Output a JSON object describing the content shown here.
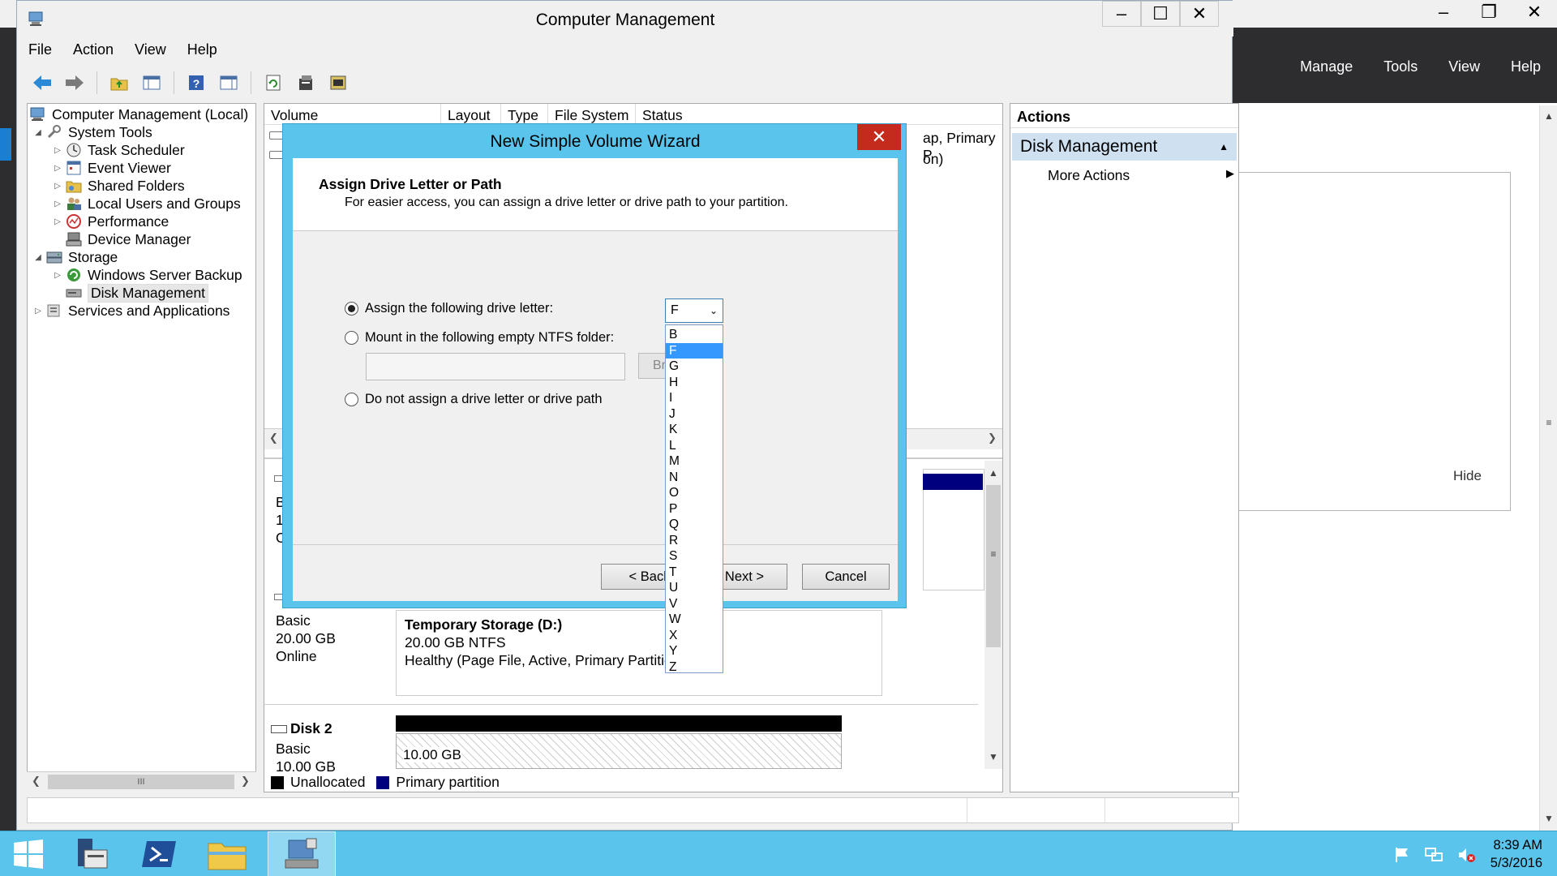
{
  "background": {
    "menu": [
      "Manage",
      "Tools",
      "View",
      "Help"
    ],
    "hide_label": "Hide"
  },
  "window": {
    "title": "Computer Management",
    "menu": [
      "File",
      "Action",
      "View",
      "Help"
    ]
  },
  "tree": {
    "root": "Computer Management (Local)",
    "system_tools": "System Tools",
    "task_scheduler": "Task Scheduler",
    "event_viewer": "Event Viewer",
    "shared_folders": "Shared Folders",
    "local_users": "Local Users and Groups",
    "performance": "Performance",
    "device_manager": "Device Manager",
    "storage": "Storage",
    "wsb": "Windows Server Backup",
    "disk_management": "Disk Management",
    "services": "Services and Applications",
    "scroll_grip": "III"
  },
  "volume_list": {
    "columns": [
      "Volume",
      "Layout",
      "Type",
      "File System",
      "Status"
    ],
    "fragment_status_1": "ap, Primary P",
    "fragment_status_2": "on)"
  },
  "disks": {
    "partial_b": "B",
    "partial_1": "1.",
    "partial_o": "O",
    "disk1_type": "Basic",
    "disk1_size": "20.00 GB",
    "disk1_state": "Online",
    "disk1_vol_name": "Temporary Storage  (D:)",
    "disk1_vol_fs": "20.00 GB NTFS",
    "disk1_vol_status": "Healthy (Page File, Active, Primary Partitio",
    "disk2_name": "Disk 2",
    "disk2_type": "Basic",
    "disk2_size": "10.00 GB",
    "disk2_unalloc_size": "10.00 GB",
    "legend_unallocated": "Unallocated",
    "legend_primary": "Primary partition",
    "color_unallocated": "#000000",
    "color_primary": "#00007f"
  },
  "actions": {
    "header": "Actions",
    "section": "Disk Management",
    "more": "More Actions"
  },
  "wizard": {
    "title": "New Simple Volume Wizard",
    "close_glyph": "✕",
    "heading": "Assign Drive Letter or Path",
    "description": "For easier access, you can assign a drive letter or drive path to your partition.",
    "option_assign": "Assign the following drive letter:",
    "option_mount": "Mount in the following empty NTFS folder:",
    "option_none": "Do not assign a drive letter or drive path",
    "browse_partial": "Bro",
    "back_label": "< Back",
    "next_label": "Next >",
    "cancel_label": "Cancel",
    "selected_letter": "F",
    "letters": [
      "B",
      "F",
      "G",
      "H",
      "I",
      "J",
      "K",
      "L",
      "M",
      "N",
      "O",
      "P",
      "Q",
      "R",
      "S",
      "T",
      "U",
      "V",
      "W",
      "X",
      "Y",
      "Z"
    ],
    "accent_color": "#5ac4ec"
  },
  "taskbar": {
    "time": "8:39 AM",
    "date": "5/3/2016"
  }
}
